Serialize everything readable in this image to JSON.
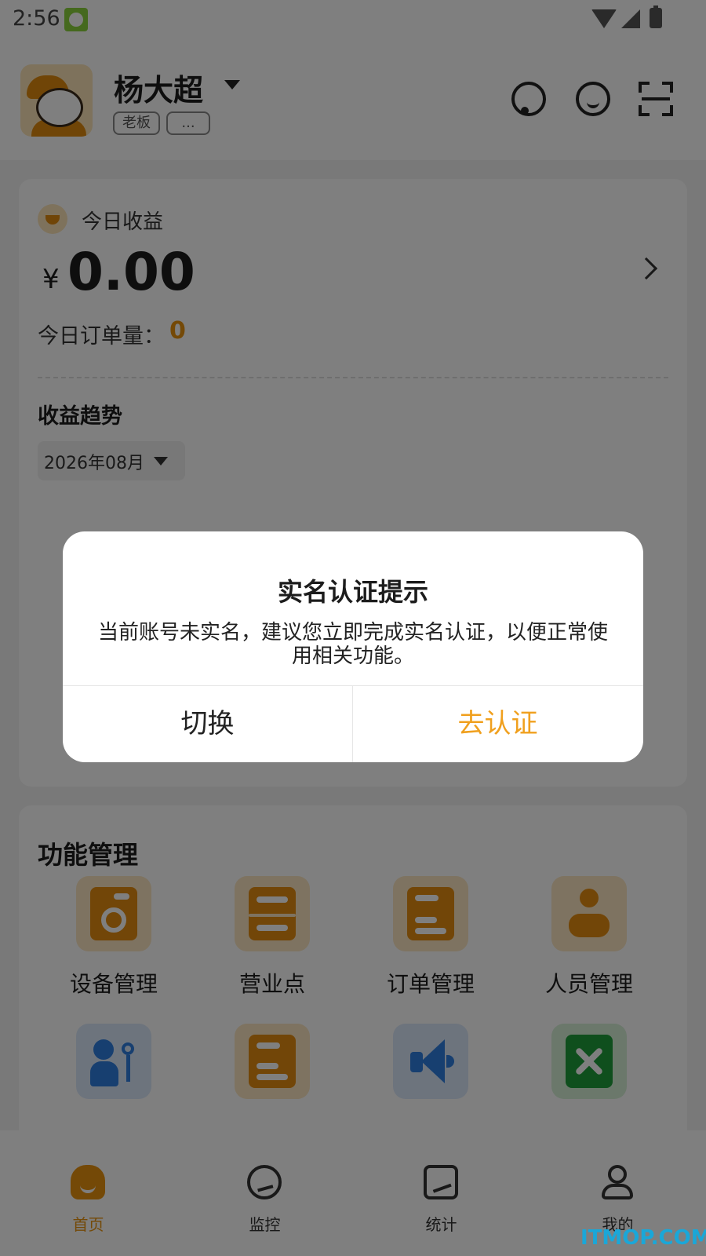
{
  "status_bar": {
    "time": "2:56"
  },
  "header": {
    "user_name": "杨大超",
    "role_tag": "老板",
    "more_tag": "..."
  },
  "earnings": {
    "label": "今日收益",
    "currency": "¥",
    "amount": "0.00",
    "order_label": "今日订单量：",
    "order_count": "0",
    "trend_title": "收益趋势",
    "month": "2026年08月"
  },
  "functions": {
    "title": "功能管理",
    "items": [
      {
        "label": "设备管理",
        "icon": "washer-icon",
        "color": "#e58c11"
      },
      {
        "label": "营业点",
        "icon": "storefront-icon",
        "color": "#e58c11"
      },
      {
        "label": "订单管理",
        "icon": "order-list-icon",
        "color": "#e58c11"
      },
      {
        "label": "人员管理",
        "icon": "staff-icon",
        "color": "#e58c11"
      },
      {
        "label": "",
        "icon": "permission-key-icon",
        "color": "#2f7fe0"
      },
      {
        "label": "",
        "icon": "document-icon",
        "color": "#e58c11"
      },
      {
        "label": "",
        "icon": "megaphone-icon",
        "color": "#2f7fe0"
      },
      {
        "label": "",
        "icon": "tools-icon",
        "color": "#1f9f3a"
      }
    ]
  },
  "bottom_nav": {
    "items": [
      {
        "label": "首页",
        "icon": "home-icon",
        "active": true
      },
      {
        "label": "监控",
        "icon": "monitor-icon",
        "active": false
      },
      {
        "label": "统计",
        "icon": "stats-icon",
        "active": false
      },
      {
        "label": "我的",
        "icon": "profile-icon",
        "active": false
      }
    ]
  },
  "dialog": {
    "title": "实名认证提示",
    "message": "当前账号未实名，建议您立即完成实名认证，以便正常使用相关功能。",
    "cancel_label": "切换",
    "confirm_label": "去认证"
  },
  "watermark": "ITMOP.COM",
  "colors": {
    "accent": "#e8920f",
    "confirm": "#f0a01e",
    "overlay": "rgba(0,0,0,0.5)"
  }
}
